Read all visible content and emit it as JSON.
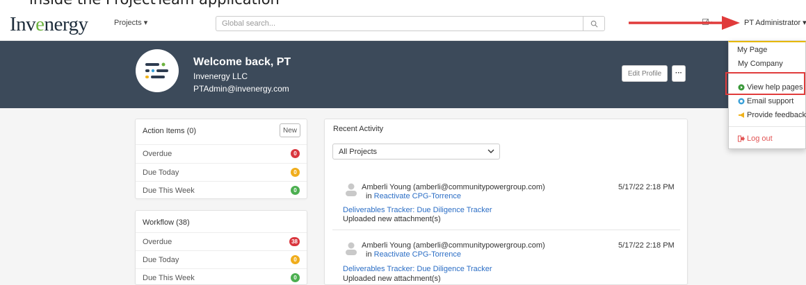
{
  "caption": {
    "text": "inside the ProjectTeam application"
  },
  "navbar": {
    "logo": {
      "pre": "Inv",
      "accent": "e",
      "post": "nergy"
    },
    "projects_menu": "Projects ▾",
    "search_placeholder": "Global search...",
    "user_menu": "PT Administrator ▾"
  },
  "header": {
    "welcome": "Welcome back, PT",
    "organization": "Invenergy LLC",
    "email": "PTAdmin@invenergy.com",
    "edit_profile": "Edit Profile",
    "more": "···"
  },
  "action_items": {
    "title": "Action Items (0)",
    "new_button": "New",
    "rows": [
      {
        "label": "Overdue",
        "count": "0",
        "color": "#d9363e"
      },
      {
        "label": "Due Today",
        "count": "0",
        "color": "#f0ad1c"
      },
      {
        "label": "Due This Week",
        "count": "0",
        "color": "#4caf50"
      }
    ]
  },
  "workflow": {
    "title": "Workflow (38)",
    "rows": [
      {
        "label": "Overdue",
        "count": "38",
        "color": "#d9363e"
      },
      {
        "label": "Due Today",
        "count": "0",
        "color": "#f0ad1c"
      },
      {
        "label": "Due This Week",
        "count": "0",
        "color": "#4caf50"
      }
    ]
  },
  "recent_activity": {
    "title": "Recent Activity",
    "filter_selected": "All Projects",
    "items": [
      {
        "user": "Amberli Young (amberli@communitypowergroup.com)",
        "in_prefix": "in",
        "project": "Reactivate CPG-Torrence",
        "date": "5/17/22 2:18 PM",
        "tracker": "Deliverables Tracker: Due Diligence Tracker",
        "description": "Uploaded new attachment(s)"
      },
      {
        "user": "Amberli Young (amberli@communitypowergroup.com)",
        "in_prefix": "in",
        "project": "Reactivate CPG-Torrence",
        "date": "5/17/22 2:18 PM",
        "tracker": "Deliverables Tracker: Due Diligence Tracker",
        "description": "Uploaded new attachment(s)"
      }
    ]
  },
  "user_dropdown": {
    "items": [
      {
        "label": "My Page",
        "icon": ""
      },
      {
        "label": "My Company",
        "icon": ""
      },
      {
        "label": "View help pages",
        "icon": "help-circle-icon"
      },
      {
        "label": "Email support",
        "icon": "support-icon"
      },
      {
        "label": "Provide feedback",
        "icon": "megaphone-icon"
      },
      {
        "label": "Log out",
        "icon": "logout-icon"
      }
    ]
  },
  "colors": {
    "header_bg": "#3c4a5a",
    "link": "#2a6dc5",
    "annotation_red": "#e03b3b"
  }
}
